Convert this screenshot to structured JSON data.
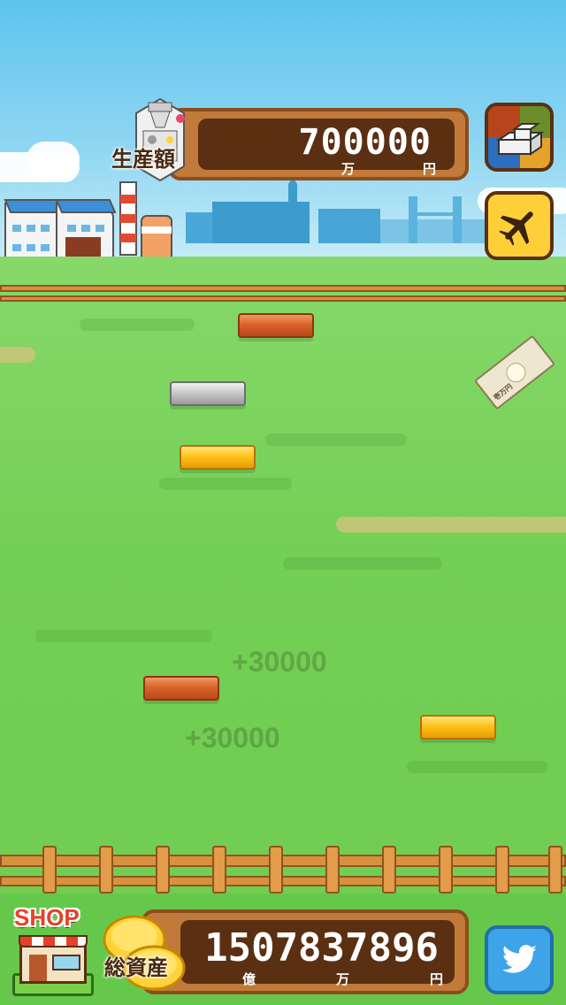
{
  "production": {
    "label": "生産額",
    "value": "700000",
    "unit_man": "万",
    "unit_yen": "円"
  },
  "total_assets": {
    "label": "総資産",
    "value": "1507837896",
    "unit_oku": "億",
    "unit_man": "万",
    "unit_yen": "円"
  },
  "shop": {
    "label": "SHOP"
  },
  "banknote": {
    "label": "壱万円"
  },
  "floating_gains": [
    "+30000",
    "+30000"
  ],
  "icons": {
    "build": "stacked-blocks-icon",
    "travel": "airplane-icon",
    "twitter": "bird-icon",
    "shop": "storefront-icon",
    "coins": "gold-coins-icon"
  },
  "colors": {
    "panel_brown": "#c17a3a",
    "panel_dark": "#5a2f12",
    "grass": "#74cf55",
    "sky": "#5ec4ee",
    "twitter_blue": "#3da4e8",
    "travel_yellow": "#ffcf3a"
  }
}
